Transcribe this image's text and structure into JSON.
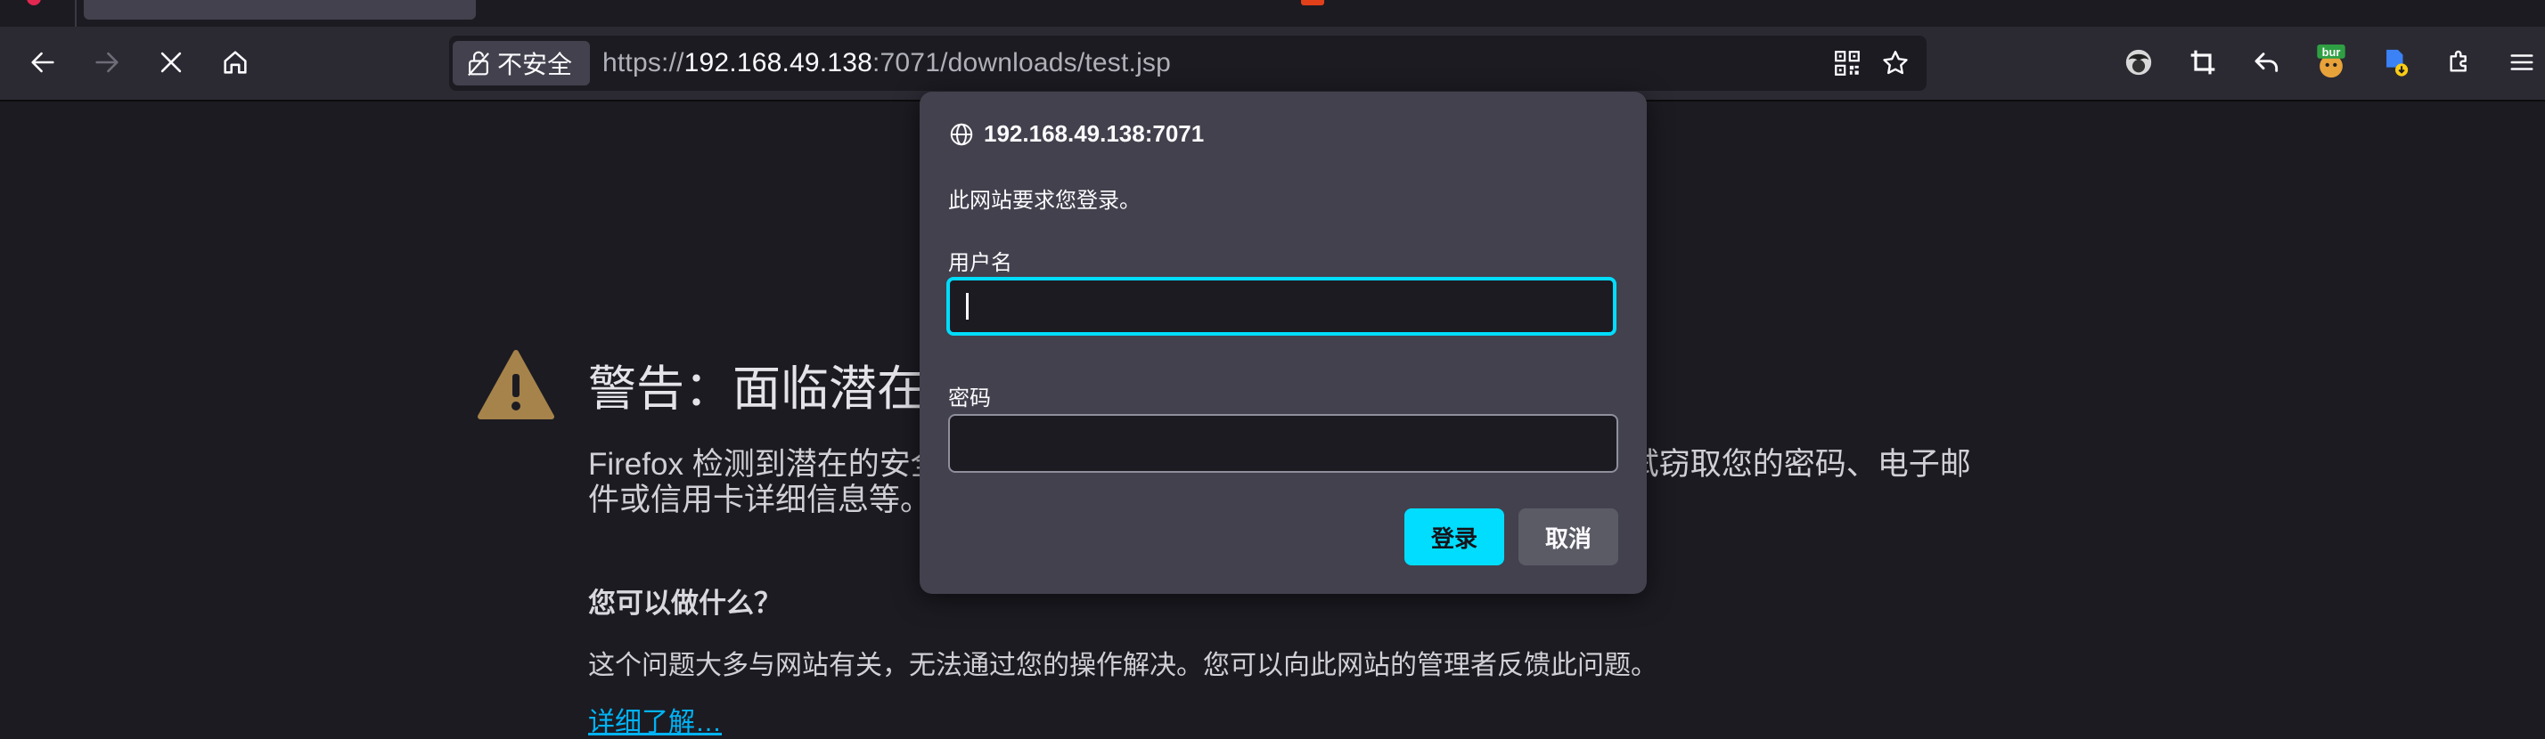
{
  "browser": {
    "security_label": "不安全",
    "url_scheme": "https://",
    "url_host": "192.168.49.138",
    "url_rest": ":7071/downloads/test.jsp",
    "extension_badge": "bur"
  },
  "page": {
    "title": "警告：面临潜在的安全风险",
    "description": "Firefox 检测到潜在的安全威胁，因此没有继续访问此网站，攻击者可能会尝试窃取您的密码、电子邮件或信用卡详细信息等。",
    "what_can_you_do": "您可以做什么？",
    "explanation": "这个问题大多与网站有关，无法通过您的操作解决。您可以向此网站的管理者反馈此问题。",
    "learn_more": "详细了解…"
  },
  "auth_dialog": {
    "host": "192.168.49.138:7071",
    "message": "此网站要求您登录。",
    "username_label": "用户名",
    "username_value": "",
    "password_label": "密码",
    "password_value": "",
    "login_button": "登录",
    "cancel_button": "取消"
  },
  "colors": {
    "accent": "#00ddff",
    "warning": "#a6834a",
    "link": "#00b3f4"
  }
}
